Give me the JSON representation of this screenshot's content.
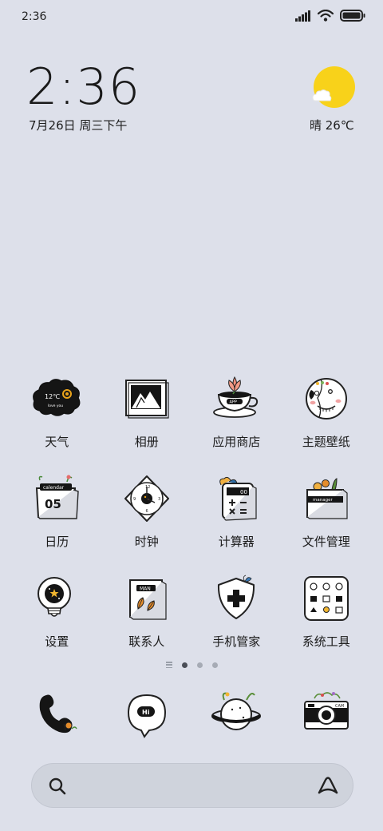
{
  "status_bar": {
    "time": "2:36"
  },
  "clock_widget": {
    "time": "2:36",
    "date": "7月26日 周三下午"
  },
  "weather_widget": {
    "text": "晴 26℃"
  },
  "apps": [
    {
      "label": "天气",
      "icon": "weather-cloud-icon"
    },
    {
      "label": "相册",
      "icon": "photo-frame-icon"
    },
    {
      "label": "应用商店",
      "icon": "coffee-cup-icon",
      "badge_text": "APP"
    },
    {
      "label": "主题壁纸",
      "icon": "smiley-face-icon"
    },
    {
      "label": "日历",
      "icon": "calendar-icon",
      "badge_text": "calendar",
      "day": "05"
    },
    {
      "label": "时钟",
      "icon": "clock-icon"
    },
    {
      "label": "计算器",
      "icon": "calculator-icon"
    },
    {
      "label": "文件管理",
      "icon": "folder-icon",
      "badge_text": "manager"
    },
    {
      "label": "设置",
      "icon": "lightbulb-icon"
    },
    {
      "label": "联系人",
      "icon": "contact-book-icon",
      "badge_text": "MAN"
    },
    {
      "label": "手机管家",
      "icon": "shield-plus-icon"
    },
    {
      "label": "系统工具",
      "icon": "tools-grid-icon"
    }
  ],
  "weather_icon_text": {
    "temp": "12℃",
    "sub": "love you"
  },
  "dock": [
    {
      "icon": "phone-icon"
    },
    {
      "icon": "message-bubble-icon",
      "badge_text": "Hi"
    },
    {
      "icon": "browser-planet-icon"
    },
    {
      "icon": "camera-icon",
      "badge_text": "CAM"
    }
  ],
  "pager": {
    "pages": 3,
    "active_index": 0
  },
  "search_bar": {}
}
